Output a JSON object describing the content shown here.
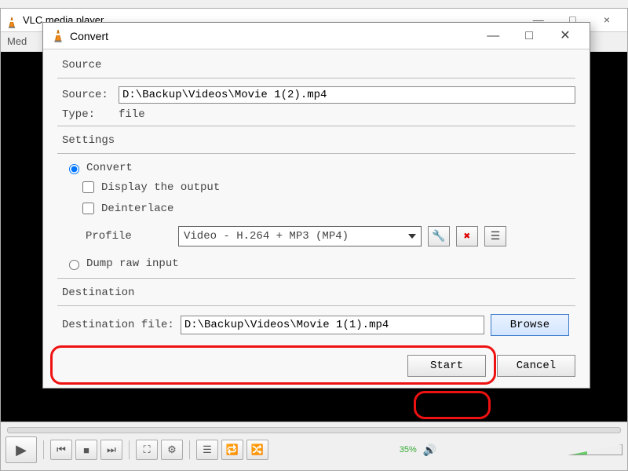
{
  "main": {
    "title": "VLC media player",
    "menu_label": "Med",
    "volume_pct": "35%"
  },
  "dialog": {
    "title": "Convert",
    "source_group": "Source",
    "source_label": "Source:",
    "source_value": "D:\\Backup\\Videos\\Movie 1(2).mp4",
    "type_label": "Type:",
    "type_value": "file",
    "settings_group": "Settings",
    "convert_label": "Convert",
    "display_label": "Display the output",
    "deinterlace_label": "Deinterlace",
    "profile_label": "Profile",
    "profile_value": "Video - H.264 + MP3 (MP4)",
    "dump_label": "Dump raw input",
    "dest_group": "Destination",
    "dest_label": "Destination file:",
    "dest_value": "D:\\Backup\\Videos\\Movie 1(1).mp4",
    "browse": "Browse",
    "start": "Start",
    "cancel": "Cancel"
  },
  "icons": {
    "wrench": "🔧",
    "cross": "✖",
    "list": "☰"
  }
}
